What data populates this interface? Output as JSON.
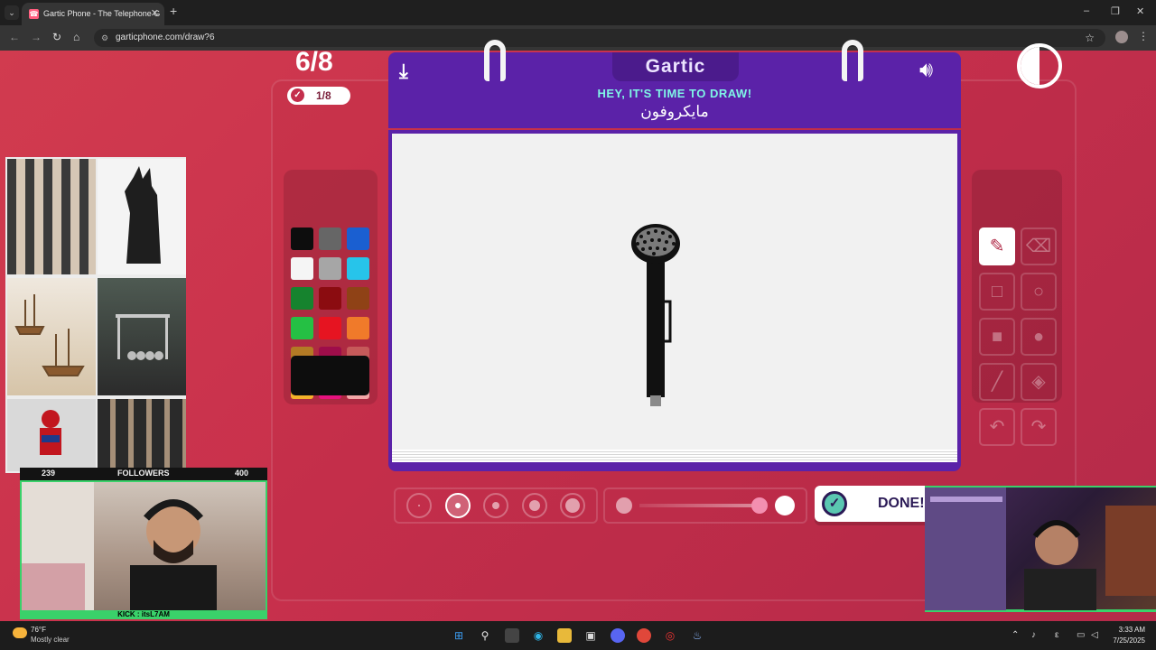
{
  "browser": {
    "tab_title": "Gartic Phone - The Telephone G",
    "tab_icon": "phone-icon",
    "url": "garticphone.com/draw?6"
  },
  "game": {
    "round": "6/8",
    "done_count": "1/8",
    "logo": "Gartic",
    "prompt": "HEY, IT'S TIME TO DRAW!",
    "word": "مايكروفون",
    "done_label": "DONE!",
    "selected_color": "#0d0d0d",
    "palette": [
      "#0d0d0d",
      "#666666",
      "#1a5fd1",
      "#f5f5f5",
      "#a6a6a6",
      "#27c4ea",
      "#16832e",
      "#8b0c10",
      "#8f4216",
      "#25c044",
      "#e61421",
      "#f07a2a",
      "#b37a25",
      "#9e0d4a",
      "#c65a5a",
      "#f4b22a",
      "#e6127e",
      "#f2a7a7"
    ],
    "tools": [
      "pencil-icon",
      "eraser-icon",
      "rectangle-outline-icon",
      "circle-outline-icon",
      "rectangle-fill-icon",
      "circle-fill-icon",
      "line-icon",
      "fill-bucket-icon",
      "undo-icon",
      "redo-icon"
    ],
    "active_tool": "pencil-icon",
    "brush_size_selected": 2,
    "opacity_level": 1.0
  },
  "stream": {
    "followers_label": "FOLLOWERS",
    "followers_min": "239",
    "followers_max": "400",
    "kick_label": "KICK : itsL7AM"
  },
  "taskbar": {
    "temperature": "76°F",
    "condition": "Mostly clear",
    "time": "3:33 AM",
    "date": "7/25/2025"
  }
}
